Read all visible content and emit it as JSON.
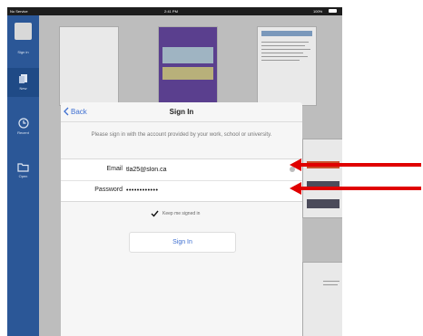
{
  "status_bar": {
    "carrier": "No Service",
    "time": "2:41 PM",
    "battery": "100%"
  },
  "sidebar": {
    "items": [
      {
        "label": "Sign in",
        "icon": "avatar-icon"
      },
      {
        "label": "New",
        "icon": "new-document-icon"
      },
      {
        "label": "Recent",
        "icon": "clock-icon"
      },
      {
        "label": "Open",
        "icon": "folder-icon"
      }
    ]
  },
  "dialog": {
    "back_label": "Back",
    "title": "Sign In",
    "message": "Please sign in with the account provided by your work, school or university.",
    "email_label": "Email",
    "email_value": "tla25@slon.ca",
    "password_label": "Password",
    "password_value": "••••••••••••",
    "keep_signed_in_label": "Keep me signed in",
    "keep_signed_in_checked": true,
    "sign_in_button": "Sign In"
  },
  "colors": {
    "sidebar": "#2b5797",
    "accent": "#3e6fd1",
    "arrow": "#e00000"
  }
}
